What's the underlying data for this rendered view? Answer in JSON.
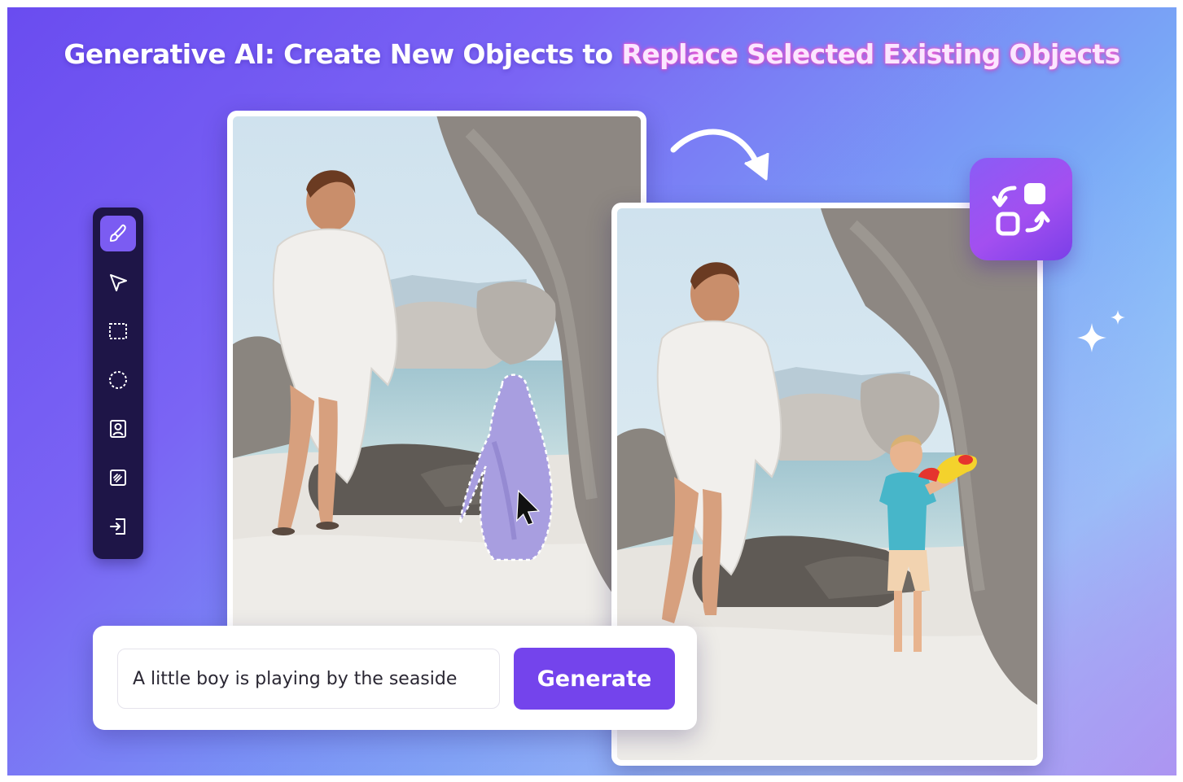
{
  "headline": {
    "part1": "Generative AI: Create New Objects to ",
    "part2": "Replace Selected Existing Objects"
  },
  "toolbar": {
    "tools": [
      {
        "icon": "brush-icon",
        "active": true
      },
      {
        "icon": "arrow-select-icon",
        "active": false
      },
      {
        "icon": "rectangle-select-icon",
        "active": false
      },
      {
        "icon": "ellipse-select-icon",
        "active": false
      },
      {
        "icon": "portrait-select-icon",
        "active": false
      },
      {
        "icon": "texture-select-icon",
        "active": false
      },
      {
        "icon": "import-icon",
        "active": false
      }
    ]
  },
  "prompt": {
    "value": "A little boy is playing by the seaside"
  },
  "actions": {
    "generate_label": "Generate"
  },
  "icons": {
    "flow_arrow": "curved-arrow-icon",
    "replace_badge": "replace-objects-icon",
    "sparkle": "sparkle-icon"
  },
  "colors": {
    "accent": "#7444ec",
    "toolbar_bg": "#1e1547",
    "tool_active": "#7b5cf2",
    "headline_highlight": "#ff5fd6"
  }
}
